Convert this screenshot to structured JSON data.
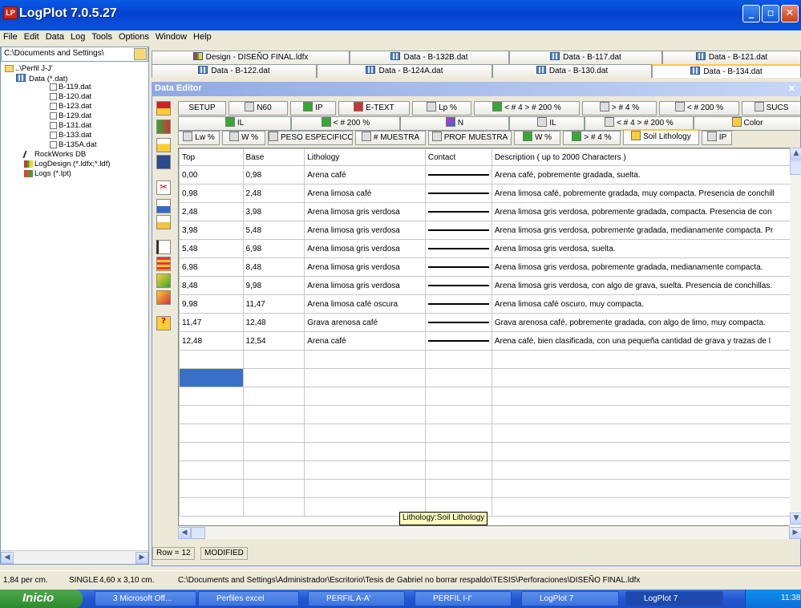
{
  "window": {
    "title": "LogPlot 7.0.5.27",
    "icon_text": "LP"
  },
  "menu": [
    "File",
    "Edit",
    "Data",
    "Log",
    "Tools",
    "Options",
    "Window",
    "Help"
  ],
  "tree": {
    "path": "C:\\Documents and Settings\\",
    "root": "..\\Perfil J-J'",
    "data_folder": "Data (*.dat)",
    "files": [
      "B-119.dat",
      "B-120.dat",
      "B-123.dat",
      "B-129.dat",
      "B-131.dat",
      "B-133.dat",
      "B-135A.dat"
    ],
    "rockworks": "RockWorks DB",
    "logdesign": "LogDesign (*.ldfx;*.ldf)",
    "logs": "Logs (*.lpt)"
  },
  "doc_tabs_row1": [
    "Design - DISEÑO FINAL.ldfx",
    "Data - B-132B.dat",
    "Data - B-117.dat",
    "Data - B-121.dat"
  ],
  "doc_tabs_row2": [
    "Data - B-122.dat",
    "Data - B-124A.dat",
    "Data - B-130.dat",
    "Data - B-134.dat"
  ],
  "data_editor": {
    "title": "Data Editor",
    "tabs_row1": [
      "SETUP",
      "N60",
      "IP",
      "E-TEXT",
      "Lp %",
      "< # 4 > # 200 %",
      "> # 4 %",
      "< # 200 %",
      "SUCS"
    ],
    "tabs_row2": [
      "IL",
      "< # 200 %",
      "N",
      "IL",
      "< # 4 > # 200 %",
      "Color"
    ],
    "tabs_row3": [
      "Lw %",
      "W %",
      "PESO ESPECIFICO",
      "# MUESTRA",
      "PROF MUESTRA",
      "W %",
      "> # 4 %",
      "Soil Lithology",
      "IP"
    ],
    "columns": [
      "Top",
      "Base",
      "Lithology",
      "Contact",
      "Description ( up to 2000 Characters )"
    ],
    "rows": [
      [
        "0,00",
        "0,98",
        "Arena café",
        "Arena café, pobremente gradada, suelta."
      ],
      [
        "0,98",
        "2,48",
        "Arena limosa café",
        "Arena limosa café, pobremente gradada, muy compacta. Presencia de conchill"
      ],
      [
        "2,48",
        "3,98",
        "Arena limosa gris verdosa",
        "Arena limosa gris verdosa, pobremente gradada, compacta. Presencia de con"
      ],
      [
        "3,98",
        "5,48",
        "Arena limosa gris verdosa",
        "Arena limosa gris verdosa, pobremente gradada, medianamente compacta. Pr"
      ],
      [
        "5,48",
        "6,98",
        "Arena limosa gris verdosa",
        "Arena limosa gris verdosa, suelta."
      ],
      [
        "6,98",
        "8,48",
        "Arena limosa gris verdosa",
        "Arena limosa gris verdosa, pobremente gradada, medianamente compacta."
      ],
      [
        "8,48",
        "9,98",
        "Arena limosa gris verdosa",
        "Arena limosa gris verdosa, con algo de grava, suelta. Presencia de conchillas."
      ],
      [
        "9,98",
        "11,47",
        "Arena limosa café oscura",
        "Arena limosa café oscuro, muy compacta."
      ],
      [
        "11,47",
        "12,48",
        "Grava arenosa café",
        "Grava arenosa café, pobremente gradada, con algo de limo, muy compacta."
      ],
      [
        "12,48",
        "12,54",
        "Arena café",
        "Arena café, bien clasificada, con una pequeña cantidad de grava y trazas de l"
      ]
    ],
    "tooltip": "Lithology:Soil Lithology",
    "row_status": "Row = 12",
    "modified": "MODIFIED"
  },
  "statusbar": {
    "scale": "1,84 per cm.",
    "mode": "SINGLE",
    "size": "4,60 x 3,10 cm.",
    "file": "C:\\Documents and Settings\\Administrador\\Escritorio\\Tesis de Gabriel no borrar respaldo\\TESIS\\Perforaciones\\DISEÑO FINAL.ldfx"
  },
  "taskbar": {
    "start": "Inicio",
    "items": [
      "3 Microsoft Off...",
      "Perfiles excel",
      "PERFIL A-A'",
      "PERFIL I-I'",
      "LogPlot 7",
      "LogPlot 7"
    ],
    "clock": "11:38"
  },
  "colors": {
    "titlebar": "#0342cf",
    "accent": "#ffc83c"
  }
}
